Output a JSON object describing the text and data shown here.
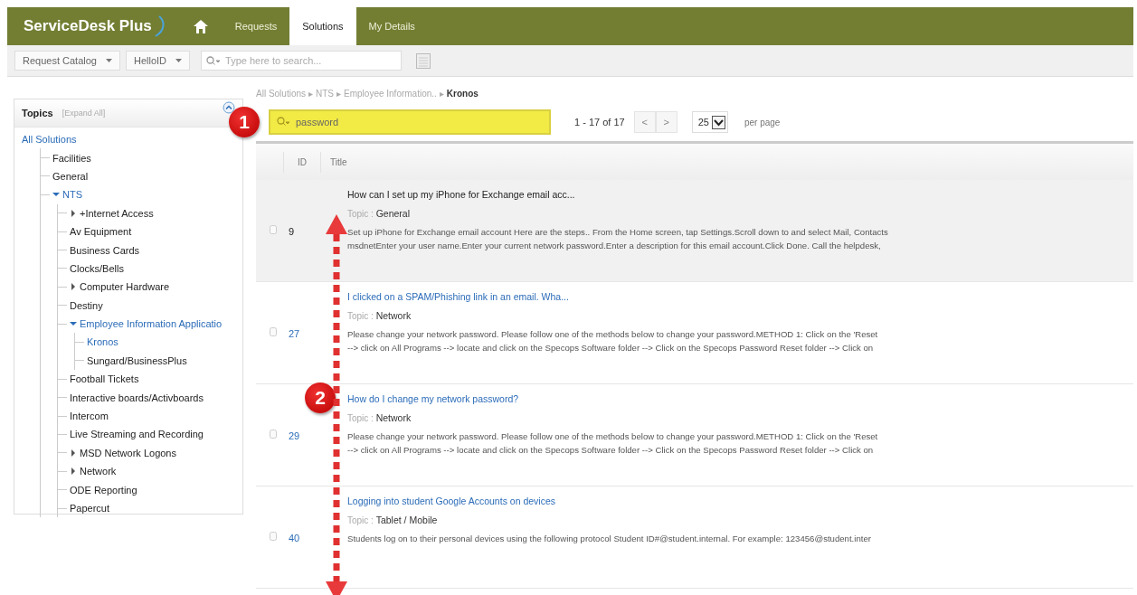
{
  "header": {
    "logo": "ServiceDesk Plus",
    "tabs": [
      {
        "label": "Requests",
        "selected": false
      },
      {
        "label": "Solutions",
        "selected": true
      },
      {
        "label": "My Details",
        "selected": false
      }
    ]
  },
  "toolbar": {
    "dropdowns": [
      "Request Catalog",
      "HelloID"
    ],
    "search": {
      "placeholder": "Type here to search..."
    }
  },
  "topics": {
    "title": "Topics",
    "expand_all": "[Expand All]",
    "tree": [
      {
        "label": "All Solutions",
        "active": true,
        "children": [
          {
            "label": "Facilities",
            "active": false
          },
          {
            "label": "General",
            "active": false
          },
          {
            "label": "NTS",
            "active": true,
            "kind": "expanded",
            "children": [
              {
                "label": "+Internet Access",
                "active": false,
                "kind": "collapsed"
              },
              {
                "label": "Av Equipment",
                "active": false
              },
              {
                "label": "Business Cards",
                "active": false
              },
              {
                "label": "Clocks/Bells",
                "active": false
              },
              {
                "label": "Computer Hardware",
                "active": false,
                "kind": "collapsed"
              },
              {
                "label": "Destiny",
                "active": false
              },
              {
                "label": "Employee Information Applicatio",
                "active": true,
                "kind": "expanded",
                "children": [
                  {
                    "label": "Kronos",
                    "active": true
                  },
                  {
                    "label": "Sungard/BusinessPlus",
                    "active": false
                  }
                ]
              },
              {
                "label": "Football Tickets",
                "active": false
              },
              {
                "label": "Interactive boards/Activboards",
                "active": false
              },
              {
                "label": "Intercom",
                "active": false
              },
              {
                "label": "Live Streaming and Recording",
                "active": false
              },
              {
                "label": "MSD Network Logons",
                "active": false,
                "kind": "collapsed"
              },
              {
                "label": "Network",
                "active": false,
                "kind": "collapsed"
              },
              {
                "label": "ODE Reporting",
                "active": false
              },
              {
                "label": "Papercut",
                "active": false
              }
            ]
          }
        ]
      }
    ]
  },
  "breadcrumb": {
    "separator": "▸",
    "items": [
      "All Solutions",
      "NTS",
      "Employee Information..",
      "Kronos"
    ]
  },
  "search": {
    "value": "password"
  },
  "pagination": {
    "range": "1 - 17 of 17",
    "prev": "<",
    "next": ">",
    "per_page": "25",
    "per_page_label": "per page"
  },
  "table": {
    "columns": [
      "ID",
      "Title"
    ],
    "rows": [
      {
        "id": "9",
        "selected": true,
        "topic_label": "Topic :",
        "title": "How can I set up my iPhone for Exchange email acc...",
        "topic": "General",
        "lines": [
          "Set up iPhone for Exchange email account Here are the steps.. From the Home screen, tap Settings.Scroll down to and select Mail, Contacts",
          "msdnetEnter your user name.Enter your current network password.Enter a description for this email account.Click Done. Call the helpdesk,"
        ]
      },
      {
        "id": "27",
        "selected": false,
        "topic_label": "Topic :",
        "title": "I clicked on a SPAM/Phishing link in an email. Wha...",
        "topic": "Network",
        "lines": [
          "Please change your network password.  Please follow one of the methods below to change your password.METHOD 1:   Click on the 'Reset",
          "--> click on All Programs --> locate and click on the Specops Software folder --> Click on the Specops Password Reset folder --> Click on"
        ]
      },
      {
        "id": "29",
        "selected": false,
        "topic_label": "Topic :",
        "title": "How do I change my network password?",
        "topic": "Network",
        "lines": [
          "Please change your network password.  Please follow one of the methods below to change your password.METHOD 1:   Click on the 'Reset",
          "--> click on All Programs --> locate and click on the Specops Software folder --> Click on the Specops Password Reset folder --> Click on"
        ]
      },
      {
        "id": "40",
        "selected": false,
        "topic_label": "Topic :",
        "title": "Logging into student Google Accounts on devices",
        "topic": "Tablet / Mobile",
        "lines": [
          "Students log on to their personal devices using the following protocol   Student ID#@student.internal.   For example: 123456@student.inter"
        ]
      }
    ]
  },
  "annotations": [
    {
      "kind": "badge",
      "label": "1"
    },
    {
      "kind": "badge",
      "label": "2"
    },
    {
      "kind": "arrow"
    }
  ]
}
